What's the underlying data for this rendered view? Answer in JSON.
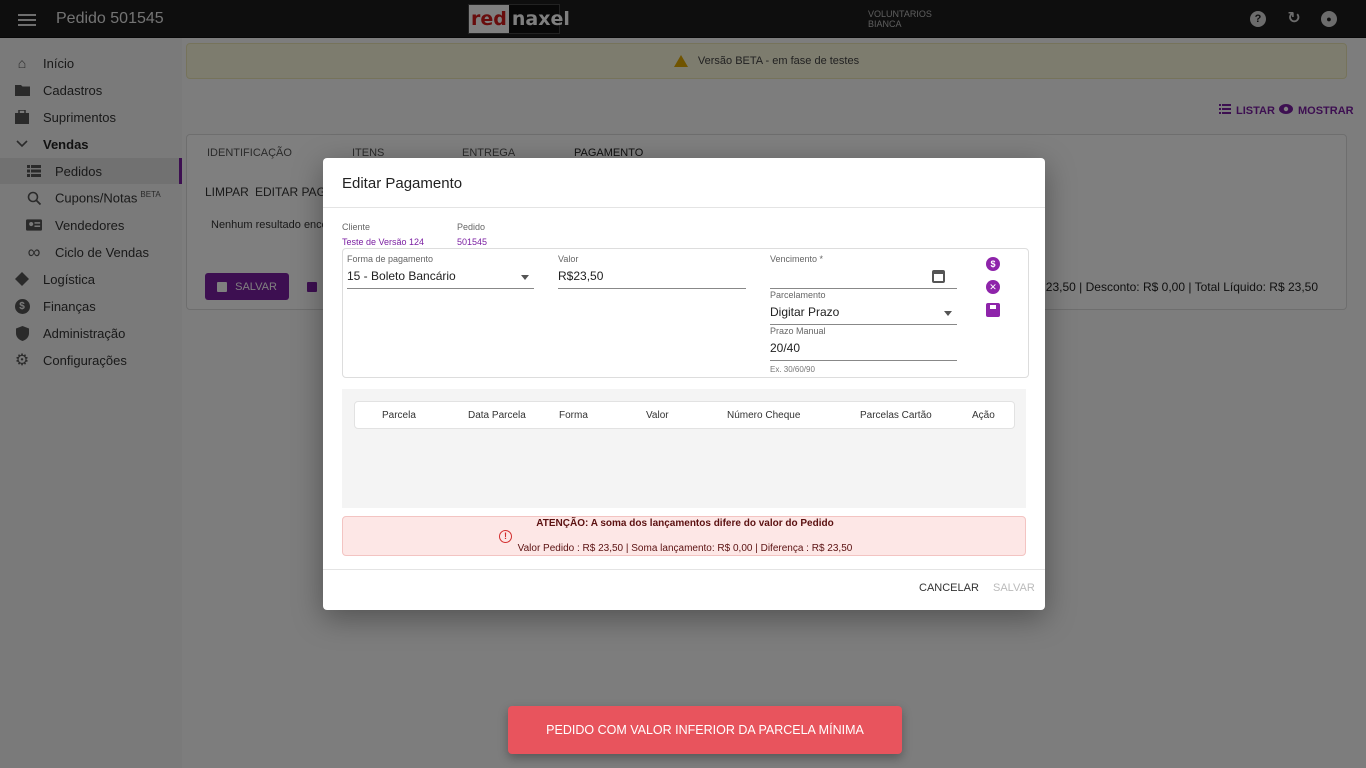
{
  "header": {
    "title": "Pedido 501545",
    "logo_red": "red",
    "logo_rest": "naxel",
    "user_line1": "VOLUNTARIOS",
    "user_line2": "BIANCA",
    "help_icon": "?",
    "refresh_icon": "↻",
    "account_icon": "●"
  },
  "sidebar": {
    "items": [
      {
        "label": "Início",
        "icon": "home-icon"
      },
      {
        "label": "Cadastros",
        "icon": "folder-icon"
      },
      {
        "label": "Suprimentos",
        "icon": "box-icon"
      },
      {
        "label": "Vendas",
        "icon": "chevron-down-icon"
      },
      {
        "label": "Pedidos",
        "icon": "list-icon"
      },
      {
        "label": "Cupons/Notas",
        "icon": "receipt-search-icon",
        "badge": "BETA"
      },
      {
        "label": "Vendedores",
        "icon": "contact-card-icon"
      },
      {
        "label": "Ciclo de Vendas",
        "icon": "infinity-icon"
      },
      {
        "label": "Logística",
        "icon": "route-icon"
      },
      {
        "label": "Finanças",
        "icon": "dollar-icon"
      },
      {
        "label": "Administração",
        "icon": "shield-icon"
      },
      {
        "label": "Configurações",
        "icon": "gear-icon"
      }
    ]
  },
  "banner": {
    "text": "Versão BETA - em fase de testes"
  },
  "top_actions": {
    "listar": "LISTAR",
    "mostrar": "MOSTRAR"
  },
  "tabs": [
    "IDENTIFICAÇÃO",
    "ITENS",
    "ENTREGA",
    "PAGAMENTO"
  ],
  "subactions": {
    "limpar": "LIMPAR",
    "editar": "EDITAR PAGA"
  },
  "no_result": "Nenhum resultado enco",
  "save_button": "SALVAR",
  "totals": "23,50 | Desconto: R$ 0,00 | Total Líquido: R$ 23,50",
  "dialog": {
    "title": "Editar Pagamento",
    "cliente_label": "Cliente",
    "cliente_value": "Teste de Versão 124",
    "pedido_label": "Pedido",
    "pedido_value": "501545",
    "forma_label": "Forma de pagamento",
    "forma_value": "15 - Boleto Bancário",
    "valor_label": "Valor",
    "valor_value": "R$23,50",
    "vencimento_label": "Vencimento *",
    "parcelamento_label": "Parcelamento",
    "parcelamento_value": "Digitar Prazo",
    "prazo_label": "Prazo Manual",
    "prazo_value": "20/40",
    "prazo_hint": "Ex. 30/60/90",
    "table_headers": [
      "Parcela",
      "Data Parcela",
      "Forma",
      "Valor",
      "Número Cheque",
      "Parcelas Cartão",
      "Ação"
    ],
    "alert_title": "ATENÇÃO: A soma dos lançamentos difere do valor do Pedido",
    "alert_detail": "Valor Pedido : R$ 23,50 | Soma lançamento: R$ 0,00 | Diferença : R$ 23,50",
    "cancel": "CANCELAR",
    "save": "SALVAR"
  },
  "snackbar": "PEDIDO COM VALOR INFERIOR DA PARCELA MÍNIMA",
  "colors": {
    "accent": "#7b1fa2",
    "snackbar": "#e8545d",
    "alert_bg": "#fde7e6"
  }
}
